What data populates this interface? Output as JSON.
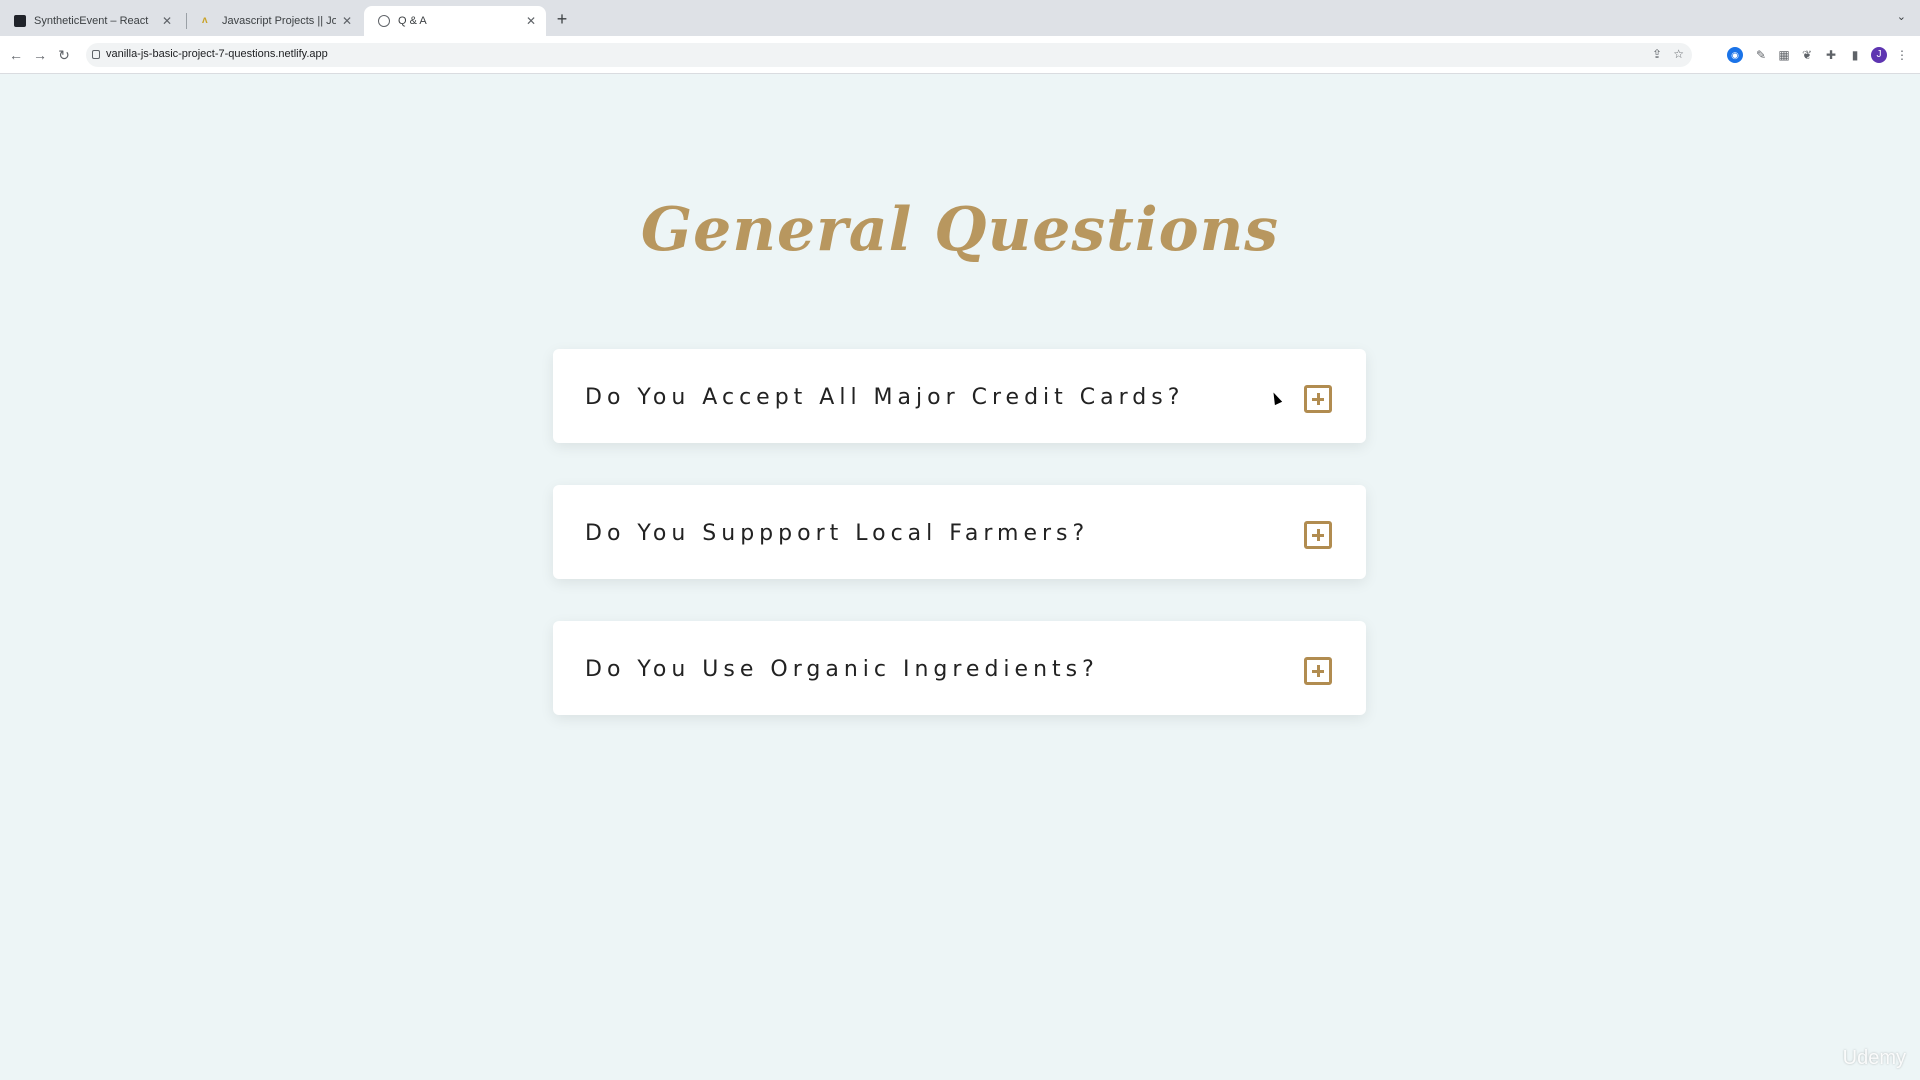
{
  "browser": {
    "tabs": [
      {
        "title": "SyntheticEvent – React",
        "icon": "react-icon"
      },
      {
        "title": "Javascript Projects || John Smi",
        "icon": "js-icon"
      },
      {
        "title": "Q & A",
        "icon": "globe-icon"
      }
    ],
    "url": "vanilla-js-basic-project-7-questions.netlify.app",
    "profile_initial": "J"
  },
  "page": {
    "heading": "General Questions",
    "questions": [
      {
        "text": "Do You Accept All Major Credit Cards?"
      },
      {
        "text": "Do You Suppport Local Farmers?"
      },
      {
        "text": "Do You Use Organic Ingredients?"
      }
    ]
  },
  "watermark": "Udemy",
  "colors": {
    "accent": "#b18c50",
    "background": "#edf5f6"
  }
}
